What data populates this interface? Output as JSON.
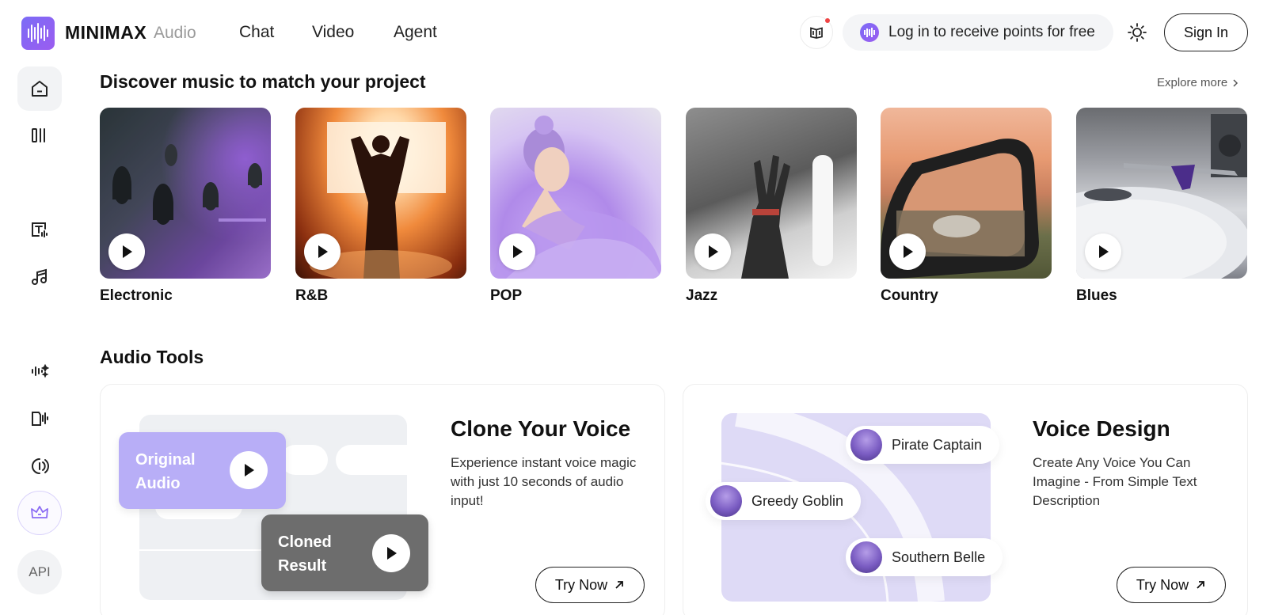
{
  "header": {
    "brand": "MINIMAX",
    "brand_sub": "Audio",
    "nav": [
      "Chat",
      "Video",
      "Agent"
    ],
    "points_text": "Log in to receive points for free",
    "signin_label": "Sign In"
  },
  "sidebar": {
    "icons": [
      "home-icon",
      "library-icon",
      "text-to-speech-icon",
      "music-note-icon",
      "voice-clone-icon",
      "voice-design-icon",
      "audio-isolation-icon",
      "crown-icon"
    ],
    "api_label": "API"
  },
  "discover": {
    "title": "Discover music to match your project",
    "explore_label": "Explore more",
    "genres": [
      {
        "label": "Electronic"
      },
      {
        "label": "R&B"
      },
      {
        "label": "POP"
      },
      {
        "label": "Jazz"
      },
      {
        "label": "Country"
      },
      {
        "label": "Blues"
      }
    ]
  },
  "tools": {
    "title": "Audio Tools",
    "clone": {
      "title": "Clone Your Voice",
      "desc": "Experience instant voice magic with just 10 seconds of audio input!",
      "original_label": "Original Audio",
      "cloned_label": "Cloned Result",
      "try_label": "Try Now"
    },
    "design": {
      "title": "Voice Design",
      "desc": "Create Any Voice You Can Imagine - From Simple Text Description",
      "voices": [
        "Pirate Captain",
        "Greedy Goblin",
        "Southern Belle"
      ],
      "try_label": "Try Now"
    }
  },
  "colors": {
    "accent": "#8b6cf4",
    "original_audio": "#b8aef7",
    "cloned_result": "#6d6d6d",
    "design_bg": "#dedaf6"
  }
}
